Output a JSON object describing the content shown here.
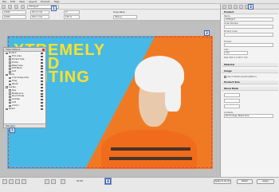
{
  "menu": [
    "File",
    "Edit",
    "View",
    "Layout",
    "Product",
    "Help"
  ],
  "toolbar": {
    "product_field": "XYProject",
    "x_field": "0.000",
    "y_field": "0.000",
    "w_field": "811.4 mm",
    "h_field": "522.7 mm",
    "rotation_field": "0°",
    "scale_field": "100 %",
    "snap_label": "Snap setup",
    "snap_value": "(None)"
  },
  "callouts": {
    "one": "1",
    "two": "2",
    "three": "3",
    "four": "4",
    "five": "5"
  },
  "artwork": {
    "headline": [
      "XTREMELY",
      "VID",
      "INTING"
    ],
    "colors": {
      "background": "#47b9e6",
      "accent": "#f07a23",
      "headline": "#ffe028"
    }
  },
  "view_options": {
    "title": "View Options",
    "rows": [
      {
        "label": "Product",
        "sub": false
      },
      {
        "label": "Trim Area",
        "sub": true
      },
      {
        "label": "Product Size",
        "sub": true
      },
      {
        "label": "Frame",
        "sub": true
      },
      {
        "label": "Bleed Area",
        "sub": true
      },
      {
        "label": "Text Block",
        "sub": true
      },
      {
        "label": "Grid",
        "sub": true
      },
      {
        "label": "Items",
        "sub": false
      },
      {
        "label": "Crop Image Area",
        "sub": true
      },
      {
        "label": "Drag",
        "sub": true
      },
      {
        "label": "Recall",
        "sub": true
      },
      {
        "label": "Guides",
        "sub": false
      },
      {
        "label": "Size",
        "sub": true
      },
      {
        "label": "Middle Line",
        "sub": true
      },
      {
        "label": "Punch Holes",
        "sub": true
      },
      {
        "label": "Overlap",
        "sub": true
      },
      {
        "label": "Grid",
        "sub": true
      },
      {
        "label": "Anchor",
        "sub": true
      },
      {
        "label": "Rulers",
        "sub": false
      }
    ],
    "swatches": [
      "#ffffff",
      "#333399",
      "#cc3333",
      "#3366cc",
      "#999999",
      "#ffffff",
      "#66cc66",
      "#ffffff",
      "#ffffff",
      "#ff66cc",
      "#ffffff",
      "#ffffff",
      "#999999",
      "#3333cc",
      "#cc9933",
      "#999999",
      "#ffffff",
      "#cc3333",
      "#ffffff"
    ],
    "footer": "Standard"
  },
  "status": {
    "zoom": "23.9%",
    "apply_all": "Apply to all (2)",
    "reset": "Reset",
    "apply": "Apply"
  },
  "right_panel": {
    "product_section": "Product",
    "name_label": "Name",
    "name_value": "XYProject",
    "order_label": "Order Number",
    "product_code_label": "Product Code",
    "format_label": "Format",
    "unit_label": "Unit",
    "unit_value": "mm",
    "size_label": "Size: 811.4 x 522.7 mm",
    "sections": [
      "Material",
      "Image",
      "Product Size",
      "Wood Mask"
    ],
    "image_chk": "Use 5 Dollars (Guide pattern)",
    "contents_label": "Contents",
    "contents_value": "Print image, Bleed area"
  }
}
